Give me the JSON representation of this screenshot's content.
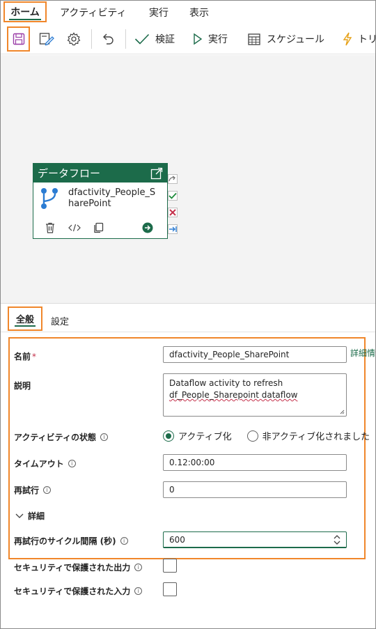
{
  "menu": {
    "items": [
      "ホーム",
      "アクティビティ",
      "実行",
      "表示"
    ]
  },
  "toolbar": {
    "save_icon": "save-icon",
    "edit_icon": "edit-icon",
    "settings_icon": "gear-icon",
    "undo_icon": "undo-icon",
    "validate_label": "検証",
    "run_label": "実行",
    "schedule_label": "スケジュール",
    "trigger_label": "トリ"
  },
  "canvas": {
    "node": {
      "type_label": "データフロー",
      "name": "dfactivity_People_SharePoint"
    }
  },
  "tabs": {
    "general": "全般",
    "settings": "設定"
  },
  "form": {
    "name_label": "名前",
    "name_required": "*",
    "name_value": "dfactivity_People_SharePoint",
    "more_link": "詳細情",
    "description_label": "説明",
    "description_line1": "Dataflow activity to refresh",
    "description_line2": "df_People_Sharepoint dataflow",
    "activity_state_label": "アクティビティの状態",
    "activate_option": "アクティブ化",
    "deactivate_option": "非アクティブ化されました",
    "timeout_label": "タイムアウト",
    "timeout_value": "0.12:00:00",
    "retry_label": "再試行",
    "retry_value": "0",
    "details_label": "詳細",
    "retry_interval_label": "再試行のサイクル間隔 (秒)",
    "retry_interval_value": "600",
    "secure_output_label": "セキュリティで保護された出力",
    "secure_input_label": "セキュリティで保護された入力"
  },
  "colors": {
    "accent": "#1c6b4a",
    "highlight": "#f0862a",
    "canvas_bg": "#f3f3f3"
  }
}
